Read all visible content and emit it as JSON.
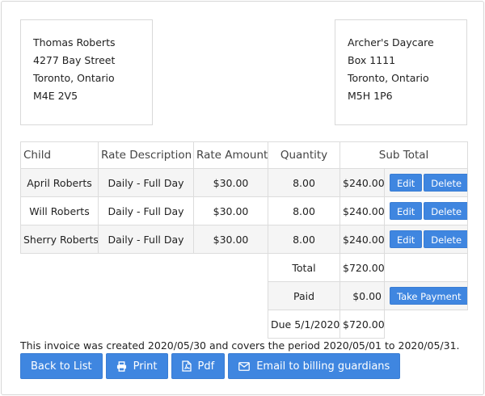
{
  "from_address": {
    "name": "Thomas Roberts",
    "street": "4277 Bay Street",
    "city": "Toronto, Ontario",
    "postal": "M4E 2V5"
  },
  "to_address": {
    "name": "Archer's Daycare",
    "street": "Box 1111",
    "city": "Toronto, Ontario",
    "postal": "M5H 1P6"
  },
  "table": {
    "headers": [
      "Child",
      "Rate Description",
      "Rate Amount",
      "Quantity",
      "Sub Total"
    ],
    "rows": [
      {
        "child": "April Roberts",
        "rate_description": "Daily - Full Day",
        "rate_amount": "$30.00",
        "quantity": "8.00",
        "sub_total": "$240.00"
      },
      {
        "child": "Will Roberts",
        "rate_description": "Daily - Full Day",
        "rate_amount": "$30.00",
        "quantity": "8.00",
        "sub_total": "$240.00"
      },
      {
        "child": "Sherry Roberts",
        "rate_description": "Daily - Full Day",
        "rate_amount": "$30.00",
        "quantity": "8.00",
        "sub_total": "$240.00"
      }
    ],
    "edit_label": "Edit",
    "delete_label": "Delete",
    "total_label": "Total",
    "total_value": "$720.00",
    "paid_label": "Paid",
    "paid_value": "$0.00",
    "take_payment_label": "Take Payment",
    "due_label": "Due 5/1/2020",
    "due_value": "$720.00"
  },
  "note": "This invoice was created 2020/05/30 and covers the period 2020/05/01 to 2020/05/31.",
  "buttons": {
    "back": "Back to List",
    "print": "Print",
    "pdf": "Pdf",
    "email": "Email to billing guardians"
  },
  "colors": {
    "button_blue": "#3f86e0",
    "border": "#dcdcdc"
  }
}
